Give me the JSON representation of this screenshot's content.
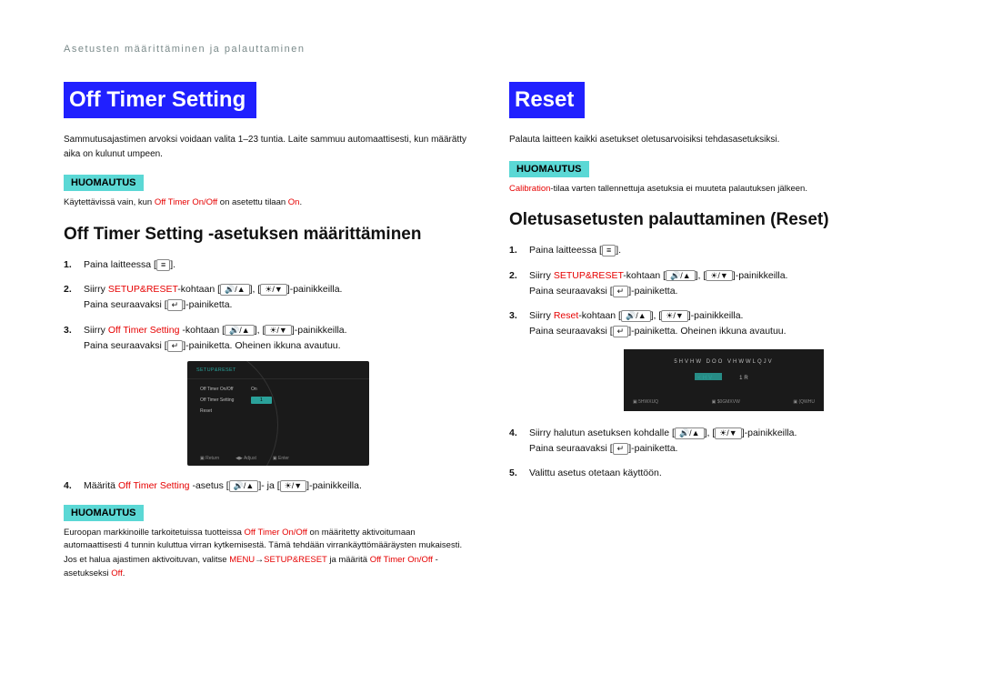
{
  "page_header": "Asetusten määrittäminen ja palauttaminen",
  "left": {
    "title": "Off Timer Setting",
    "intro": "Sammutusajastimen arvoksi voidaan valita 1–23 tuntia. Laite sammuu automaattisesti, kun määrätty aika on kulunut umpeen.",
    "notice_label": "HUOMAUTUS",
    "notice1_pre": "Käytettävissä vain, kun ",
    "notice1_red1": "Off Timer On/Off",
    "notice1_mid": " on asetettu tilaan ",
    "notice1_red2": "On",
    "notice1_post": ".",
    "subhead": "Off Timer Setting -asetuksen määrittäminen",
    "steps": {
      "s1_pre": "Paina laitteessa [",
      "s1_icon": "MENU",
      "s1_post": "].",
      "s2_pre": "Siirry ",
      "s2_red": "SETUP&RESET",
      "s2_mid": "-kohtaan [",
      "s2_post": "]-painikkeilla.",
      "s2b_pre": "Paina seuraavaksi [",
      "s2b_post": "]-painiketta.",
      "s3_pre": "Siirry ",
      "s3_red": "Off Timer Setting",
      "s3_mid": " -kohtaan [",
      "s3_post": "]-painikkeilla.",
      "s3b_pre": "Paina seuraavaksi [",
      "s3b_post": "]-painiketta. Oheinen ikkuna avautuu.",
      "s4_pre": "Määritä ",
      "s4_red": "Off Timer Setting",
      "s4_mid": " -asetus [",
      "s4_mid2": "]- ja [",
      "s4_post": "]-painikkeilla."
    },
    "osd": {
      "header": "SETUP&RESET",
      "row1": "Off Timer On/Off",
      "row1v": "On",
      "row2": "Off Timer Setting",
      "row2v": "1",
      "row3": "Reset",
      "foot1": "Return",
      "foot2": "Adjust",
      "foot3": "Enter"
    },
    "notice2_label": "HUOMAUTUS",
    "notice2_a": "Euroopan markkinoille tarkoitetuissa tuotteissa ",
    "notice2_red1": "Off Timer On/Off",
    "notice2_b": " on määritetty aktivoitumaan automaattisesti 4 tunnin kuluttua virran kytkemisestä. Tämä tehdään virrankäyttömääräysten mukaisesti. Jos et halua ajastimen aktivoituvan, valitse ",
    "notice2_red2": "MENU",
    "notice2_arrow": " → ",
    "notice2_red3": "SETUP&RESET",
    "notice2_c": " ja määritä ",
    "notice2_red4": "Off Timer On/Off",
    "notice2_d": " -asetukseksi ",
    "notice2_red5": "Off",
    "notice2_e": "."
  },
  "right": {
    "title": "Reset",
    "intro": "Palauta laitteen kaikki asetukset oletusarvoisiksi tehdasasetuksiksi.",
    "notice_label": "HUOMAUTUS",
    "notice1_red": "Calibration",
    "notice1_rest": "-tilaa varten tallennettuja asetuksia ei muuteta palautuksen jälkeen.",
    "subhead": "Oletusasetusten palauttaminen (Reset)",
    "steps": {
      "s1_pre": "Paina laitteessa [",
      "s1_post": "].",
      "s2_pre": "Siirry ",
      "s2_red": "SETUP&RESET",
      "s2_mid": "-kohtaan [",
      "s2_post": "]-painikkeilla.",
      "s2b_pre": "Paina seuraavaksi [",
      "s2b_post": "]-painiketta.",
      "s3_pre": "Siirry ",
      "s3_red": "Reset",
      "s3_mid": "-kohtaan [",
      "s3_post": "]-painikkeilla.",
      "s3b_pre": "Paina seuraavaksi [",
      "s3b_post": "]-painiketta. Oheinen ikkuna avautuu.",
      "s4_pre": "Siirry halutun asetuksen kohdalle [",
      "s4_post": "]-painikkeilla.",
      "s4b_pre": "Paina seuraavaksi [",
      "s4b_post": "]-painiketta.",
      "s5": "Valittu asetus otetaan käyttöön."
    },
    "osd": {
      "t1": "5HVHW DOO VHWWLQJV",
      "yes": "<HV",
      "no": "1R",
      "f1": "5HWXUQ",
      "f2": "$0GMXVW",
      "f3": "(QWHU"
    }
  },
  "icons": {
    "menu": "≡",
    "vol_up": "🔊/▲",
    "bright_down": "☀/▼",
    "enter": "↵"
  }
}
